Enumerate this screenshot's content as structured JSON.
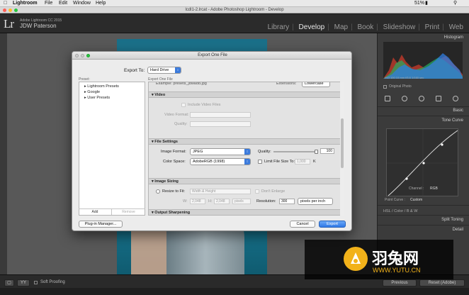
{
  "menubar": {
    "app": "Lightroom",
    "items": [
      "File",
      "Edit",
      "Window",
      "Help"
    ],
    "status": "51%"
  },
  "window": {
    "title": "lcdl1-2.lrcat - Adobe Photoshop Lightroom - Develop"
  },
  "identity": {
    "logo": "Lr",
    "product": "Adobe Lightroom CC 2015",
    "user": "JDW Paterson"
  },
  "modules": [
    "Library",
    "Develop",
    "Map",
    "Book",
    "Slideshow",
    "Print",
    "Web"
  ],
  "active_module": "Develop",
  "right_panel": {
    "histogram": "Histogram",
    "hist_info": "ISO 100   10 mm   f/5.6   1/160 sec",
    "original_photo": "Original Photo",
    "basic": "Basic",
    "tone_curve": "Tone Curve",
    "channel_label": "Channel :",
    "channel_value": "RGB",
    "point_curve_label": "Point Curve :",
    "point_curve_value": "Custom",
    "hsl": "HSL",
    "color": "Color",
    "bw": "B & W",
    "split_toning": "Split Toning",
    "detail": "Detail"
  },
  "bottom": {
    "soft_proofing": "Soft Proofing",
    "previous": "Previous",
    "reset": "Reset (Adobe)"
  },
  "dialog": {
    "title": "Export One File",
    "export_to_label": "Export To:",
    "export_to_value": "Hard Drive",
    "preset_header": "Preset:",
    "right_header": "Export One File",
    "presets": [
      "Lightroom Presets",
      "Google",
      "User Presets"
    ],
    "add": "Add",
    "remove": "Remove",
    "example_line": "Example: presets_jdwadd.jpg",
    "extensions_label": "Extensions:",
    "extensions_value": "Lowercase",
    "video": {
      "header": "Video",
      "include": "Include Video Files",
      "format_label": "Video Format:",
      "quality_label": "Quality:"
    },
    "file_settings": {
      "header": "File Settings",
      "format_label": "Image Format:",
      "format_value": "JPEG",
      "quality_label": "Quality:",
      "quality_value": "100",
      "colorspace_label": "Color Space:",
      "colorspace_value": "AdobeRGB (1998)",
      "limit_label": "Limit File Size To:",
      "limit_value": "1,000",
      "limit_unit": "K"
    },
    "image_sizing": {
      "header": "Image Sizing",
      "resize_label": "Resize to Fit:",
      "resize_value": "Width & Height",
      "enlarge_label": "Don't Enlarge",
      "w_label": "W:",
      "w_value": "2,048",
      "h_label": "H:",
      "h_value": "2,048",
      "units": "pixels",
      "resolution_label": "Resolution:",
      "resolution_value": "300",
      "resolution_unit": "pixels per inch"
    },
    "output_sharpening": {
      "header": "Output Sharpening"
    },
    "plugin_manager": "Plug-in Manager...",
    "cancel": "Cancel",
    "export": "Export"
  },
  "watermark": {
    "name": "羽兔网",
    "url": "WWW.YUTU.CN"
  },
  "colors": {
    "accent": "#3c7bdc",
    "watermark": "#f2b21a"
  }
}
